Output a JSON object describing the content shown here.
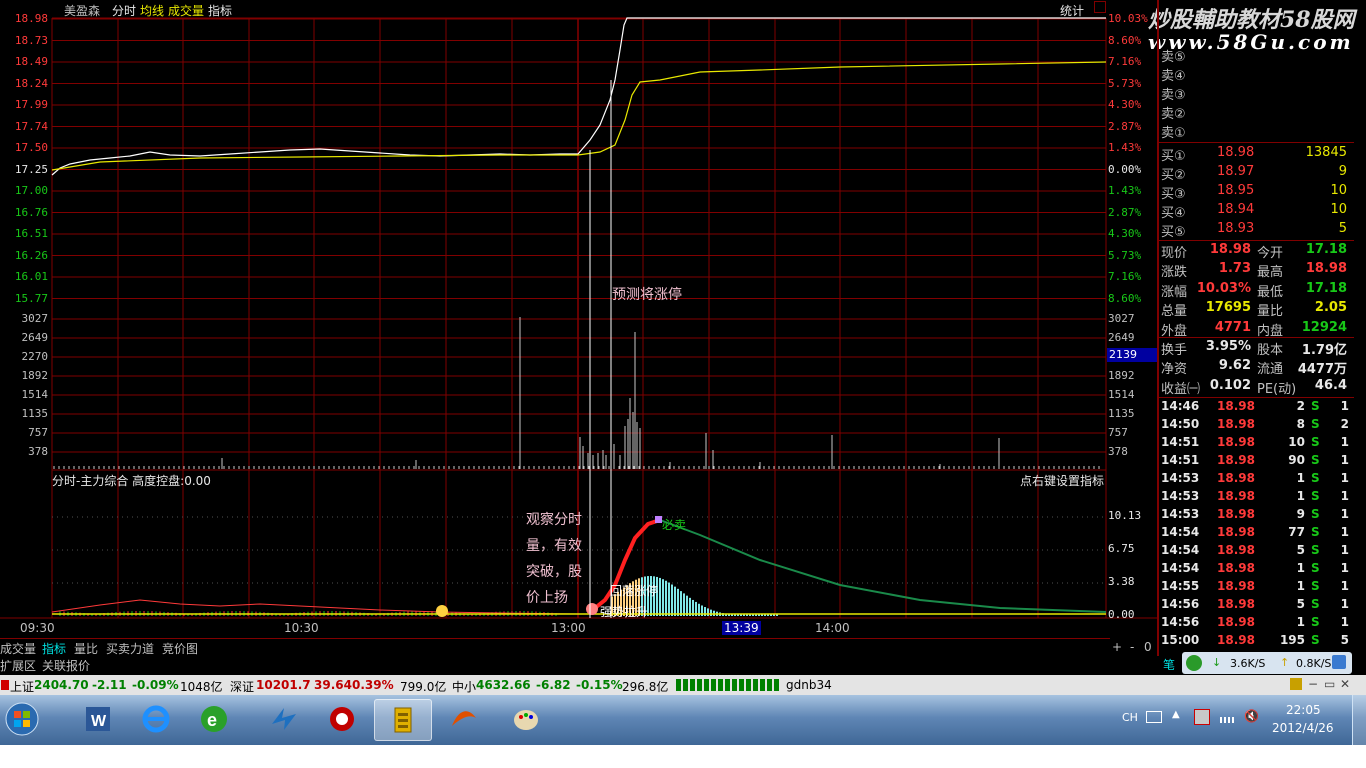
{
  "header": {
    "stock_name": "美盈森",
    "tab_fenshi": "分时",
    "tab_junxian": "均线",
    "tab_chengjiaoliang": "成交量",
    "tab_zhibiao": "指标",
    "tongji": "统计"
  },
  "watermark": {
    "line1": "炒股輔助教材58股网",
    "line2": "www.58Gu.com"
  },
  "price_axis_left": [
    "18.98",
    "18.73",
    "18.49",
    "18.24",
    "17.99",
    "17.74",
    "17.50",
    "17.25",
    "17.00",
    "16.76",
    "16.51",
    "16.26",
    "16.01",
    "15.77"
  ],
  "pct_axis_right": [
    "10.03%",
    "8.60%",
    "7.16%",
    "5.73%",
    "4.30%",
    "2.87%",
    "1.43%",
    "0.00%",
    "1.43%",
    "2.87%",
    "4.30%",
    "5.73%",
    "7.16%",
    "8.60%"
  ],
  "volume_axis": [
    "3027",
    "2649",
    "2270",
    "1892",
    "1514",
    "1135",
    "757",
    "378"
  ],
  "volume_highlight": "2139",
  "indicator": {
    "title": "分时-主力综合  高度控盘:0.00",
    "hint": "点右键设置指标",
    "axis": [
      "10.13",
      "6.75",
      "3.38",
      "0.00"
    ]
  },
  "annotations": {
    "predict": "预测将涨停",
    "observe_lines": [
      "观察分时",
      "量，有效",
      "突破，股",
      "价上扬"
    ],
    "must_sell": "必卖",
    "huiluo": "回落涨停",
    "rise_hint": "强势拉升"
  },
  "time_axis": [
    "09:30",
    "10:30",
    "13:00",
    "13:39",
    "14:00"
  ],
  "bottom_tabs": [
    "成交量",
    "指标",
    "量比",
    "买卖力道",
    "竞价图"
  ],
  "bottom_ctrl": [
    "+",
    "-",
    "0"
  ],
  "sub_tabs": [
    "扩展区",
    "关联报价"
  ],
  "order_book": {
    "sells": [
      {
        "label": "卖⑤",
        "price": "",
        "vol": ""
      },
      {
        "label": "卖④",
        "price": "",
        "vol": ""
      },
      {
        "label": "卖③",
        "price": "",
        "vol": ""
      },
      {
        "label": "卖②",
        "price": "",
        "vol": ""
      },
      {
        "label": "卖①",
        "price": "",
        "vol": ""
      }
    ],
    "buys": [
      {
        "label": "买①",
        "price": "18.98",
        "vol": "13845"
      },
      {
        "label": "买②",
        "price": "18.97",
        "vol": "9"
      },
      {
        "label": "买③",
        "price": "18.95",
        "vol": "10"
      },
      {
        "label": "买④",
        "price": "18.94",
        "vol": "10"
      },
      {
        "label": "买⑤",
        "price": "18.93",
        "vol": "5"
      }
    ]
  },
  "stats": [
    {
      "l1": "现价",
      "v1": "18.98",
      "l2": "今开",
      "v2": "17.18"
    },
    {
      "l1": "涨跌",
      "v1": "1.73",
      "l2": "最高",
      "v2": "18.98"
    },
    {
      "l1": "涨幅",
      "v1": "10.03%",
      "l2": "最低",
      "v2": "17.18"
    },
    {
      "l1": "总量",
      "v1": "17695",
      "l2": "量比",
      "v2": "2.05"
    },
    {
      "l1": "外盘",
      "v1": "4771",
      "l2": "内盘",
      "v2": "12924"
    },
    {
      "l1": "换手",
      "v1": "3.95%",
      "l2": "股本",
      "v2": "1.79亿"
    },
    {
      "l1": "净资",
      "v1": "9.62",
      "l2": "流通",
      "v2": "4477万"
    },
    {
      "l1": "收益㈠",
      "v1": "0.102",
      "l2": "PE(动)",
      "v2": "46.4"
    }
  ],
  "ticks": [
    {
      "t": "14:46",
      "p": "18.98",
      "v": "2",
      "s": "S",
      "n": "1"
    },
    {
      "t": "14:50",
      "p": "18.98",
      "v": "8",
      "s": "S",
      "n": "2"
    },
    {
      "t": "14:51",
      "p": "18.98",
      "v": "10",
      "s": "S",
      "n": "1"
    },
    {
      "t": "14:51",
      "p": "18.98",
      "v": "90",
      "s": "S",
      "n": "1"
    },
    {
      "t": "14:53",
      "p": "18.98",
      "v": "1",
      "s": "S",
      "n": "1"
    },
    {
      "t": "14:53",
      "p": "18.98",
      "v": "1",
      "s": "S",
      "n": "1"
    },
    {
      "t": "14:53",
      "p": "18.98",
      "v": "9",
      "s": "S",
      "n": "1"
    },
    {
      "t": "14:54",
      "p": "18.98",
      "v": "77",
      "s": "S",
      "n": "1"
    },
    {
      "t": "14:54",
      "p": "18.98",
      "v": "5",
      "s": "S",
      "n": "1"
    },
    {
      "t": "14:54",
      "p": "18.98",
      "v": "1",
      "s": "S",
      "n": "1"
    },
    {
      "t": "14:55",
      "p": "18.98",
      "v": "1",
      "s": "S",
      "n": "1"
    },
    {
      "t": "14:56",
      "p": "18.98",
      "v": "5",
      "s": "S",
      "n": "1"
    },
    {
      "t": "14:56",
      "p": "18.98",
      "v": "1",
      "s": "S",
      "n": "1"
    },
    {
      "t": "15:00",
      "p": "18.98",
      "v": "195",
      "s": "S",
      "n": "5"
    }
  ],
  "panel_bottom": {
    "label": "笔",
    "speed1": "3.6K/S",
    "speed2": "0.8K/S"
  },
  "ticker": {
    "sh_label": "上证",
    "sh_val": "2404.70",
    "sh_chg": "-2.11",
    "sh_pct": "-0.09%",
    "sh_amt": "1048亿",
    "sz_label": "深证",
    "sz_val": "10201.7",
    "sz_chg": "39.64",
    "sz_pct": "0.39%",
    "sz_amt": "799.0亿",
    "zx_label": "中小",
    "zx_val": "4632.66",
    "zx_chg": "-6.82",
    "zx_pct": "-0.15%",
    "zx_amt": "296.8亿",
    "account": "gdnb34"
  },
  "taskbar": {
    "ime": "CH",
    "time": "22:05",
    "date": "2012/4/26"
  },
  "colors": {
    "grid": "#800000",
    "price": "#ffffff",
    "avg": "#e8e800",
    "up": "#ff3a3a",
    "down": "#18c818",
    "volume": "#c8c8c8"
  }
}
